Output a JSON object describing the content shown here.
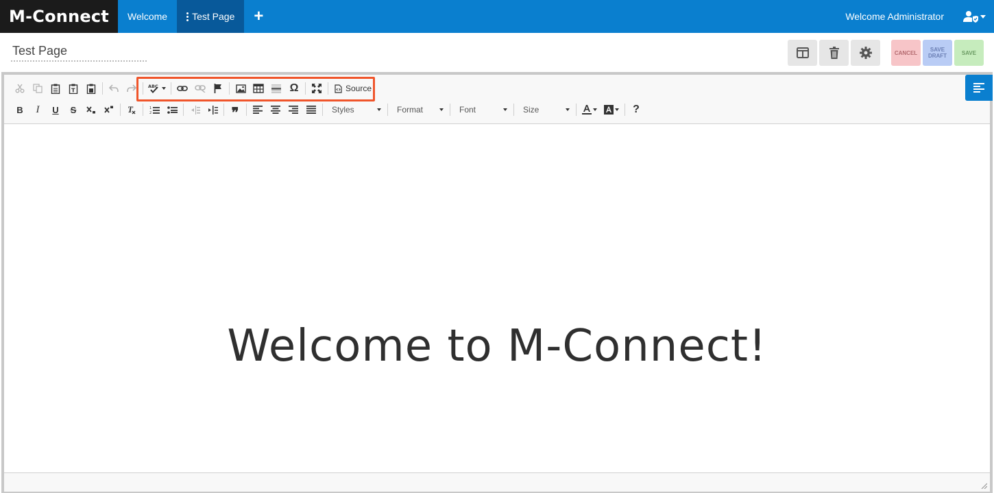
{
  "app": {
    "brand": "M-Connect"
  },
  "nav": {
    "tabs": [
      {
        "label": "Welcome"
      },
      {
        "label": "Test Page"
      }
    ],
    "add_tab": "+",
    "welcome_user": "Welcome Administrator"
  },
  "page": {
    "title": "Test Page",
    "actions": {
      "cancel": "CANCEL",
      "save_draft": "SAVE DRAFT",
      "save": "SAVE"
    }
  },
  "toolbar": {
    "source_label": "Source",
    "styles_label": "Styles",
    "format_label": "Format",
    "font_label": "Font",
    "size_label": "Size",
    "help_label": "?",
    "bold": "B",
    "italic": "I",
    "underline": "U",
    "strike": "S",
    "omega": "Ω",
    "spell_label": "ABC",
    "quote": "❞"
  },
  "content": {
    "headline": "Welcome to M-Connect!"
  },
  "colors": {
    "nav_blue": "#0a7fcf",
    "nav_active": "#08599a",
    "brand_bg": "#1b1b1b",
    "highlight": "#f0552b"
  }
}
